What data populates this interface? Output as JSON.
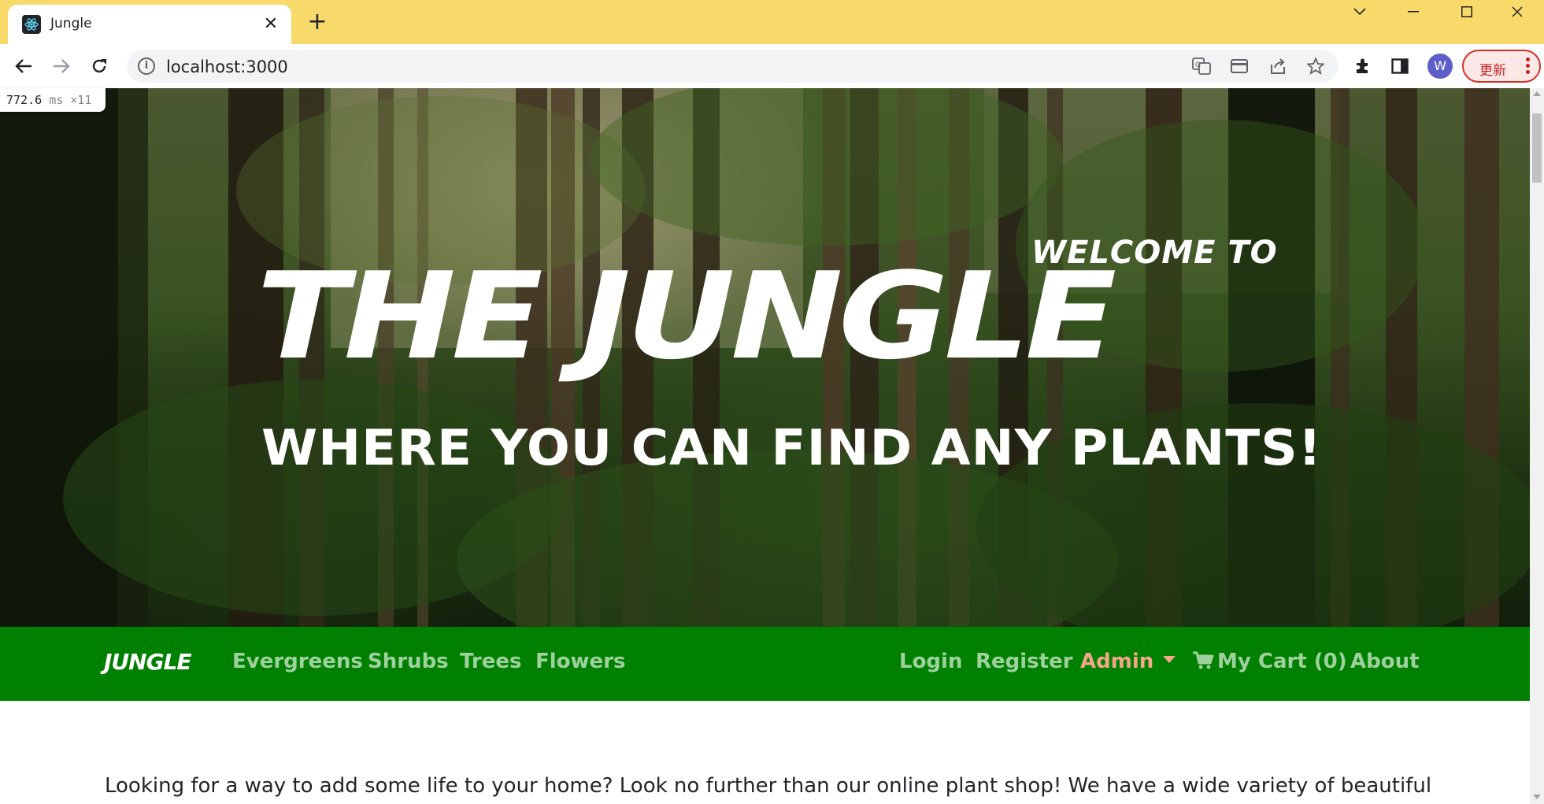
{
  "browser": {
    "tab_title": "Jungle",
    "url": "localhost:3000",
    "update_label": "更新",
    "profile_initial": "W"
  },
  "perf_badge": {
    "value": "772.6",
    "unit": "ms",
    "multiplier": "×11"
  },
  "hero": {
    "welcome": "WELCOME TO",
    "title": "THE JUNGLE",
    "tagline": "WHERE YOU CAN FIND ANY PLANTS!"
  },
  "nav": {
    "brand": "JUNGLE",
    "categories": [
      "Evergreens",
      "Shrubs",
      "Trees",
      "Flowers"
    ],
    "login": "Login",
    "register": "Register",
    "admin": "Admin",
    "cart": "My Cart (0)",
    "about": "About"
  },
  "content": {
    "intro": "Looking for a way to add some life to your home? Look no further than our online plant shop! We have a wide variety of beautiful"
  },
  "colors": {
    "tabstrip": "#f8da6b",
    "navbar": "#008000",
    "nav_link": "#9fd19f",
    "admin_link": "#f4a58a"
  }
}
